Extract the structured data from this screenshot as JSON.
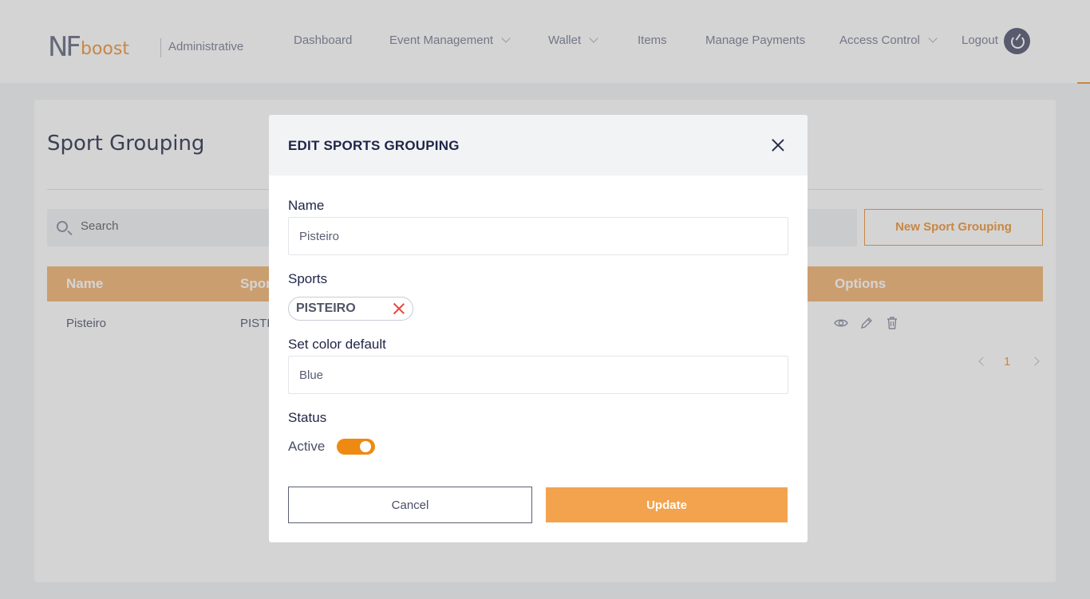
{
  "header": {
    "logo_nf": "NF",
    "logo_boost": "boost",
    "subtitle": "Administrative",
    "nav": [
      {
        "label": "Dashboard",
        "dropdown": false
      },
      {
        "label": "Event Management",
        "dropdown": true
      },
      {
        "label": "Wallet",
        "dropdown": true
      },
      {
        "label": "Items",
        "dropdown": false
      },
      {
        "label": "Manage Payments",
        "dropdown": false
      },
      {
        "label": "Access Control",
        "dropdown": true
      },
      {
        "label": "Logout",
        "dropdown": false
      }
    ]
  },
  "page": {
    "title": "Sport Grouping",
    "search_placeholder": "Search",
    "new_button": "New Sport Grouping",
    "table": {
      "columns": [
        "Name",
        "Spor",
        "Options"
      ],
      "rows": [
        {
          "name": "Pisteiro",
          "sports": "PISTE"
        }
      ]
    },
    "pagination": {
      "current": "1"
    }
  },
  "modal": {
    "title": "EDIT SPORTS GROUPING",
    "name_label": "Name",
    "name_value": "Pisteiro",
    "sports_label": "Sports",
    "sports_tags": [
      "PISTEIRO"
    ],
    "color_label": "Set color default",
    "color_value": "Blue",
    "status_label": "Status",
    "status_text": "Active",
    "status_on": true,
    "cancel_label": "Cancel",
    "update_label": "Update"
  },
  "colors": {
    "accent": "#f3a34e",
    "toggle": "#ee8a12",
    "table_header": "#f5bf86",
    "remove_x": "#e5483b"
  }
}
